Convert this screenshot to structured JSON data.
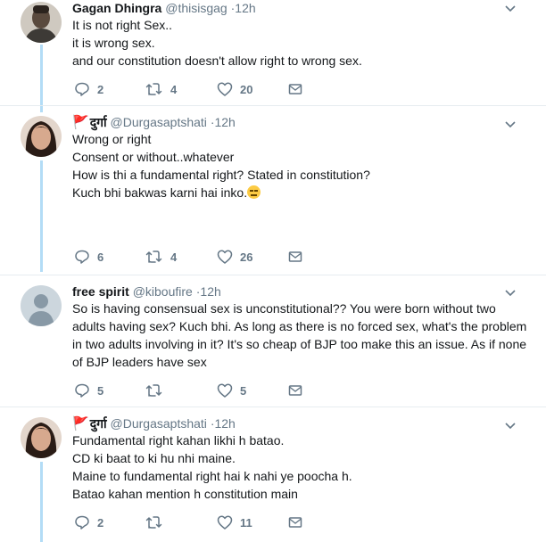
{
  "tweets": [
    {
      "name": "Gagan Dhingra",
      "handle": "@thisisgag",
      "time": "12h",
      "lines": [
        "It is not right Sex..",
        "it is wrong sex.",
        "and our constitution doesn't allow right to wrong sex."
      ],
      "replies": "2",
      "retweets": "4",
      "likes": "20"
    },
    {
      "flag": "🚩",
      "name": "दुर्गा",
      "handle": "@Durgasaptshati",
      "time": "12h",
      "lines": [
        "Wrong or right",
        "Consent or without..whatever",
        "",
        "How is thi a fundamental right? Stated in constitution?",
        "",
        "Kuch bhi bakwas karni hai inko."
      ],
      "emoji": "expressionless-face",
      "replies": "6",
      "retweets": "4",
      "likes": "26"
    },
    {
      "name": "free spirit",
      "handle": "@kiboufire",
      "time": "12h",
      "lines": [
        "So is having consensual sex is unconstitutional?? You were born without two",
        "adults having sex? Kuch bhi. As long as there is no forced sex, what's the problem",
        "in two adults involving in it? It's so cheap of BJP too make this an issue. As if none",
        "of BJP leaders have sex"
      ],
      "replies": "5",
      "retweets": "",
      "likes": "5"
    },
    {
      "flag": "🚩",
      "name": "दुर्गा",
      "handle": "@Durgasaptshati",
      "time": "12h",
      "lines": [
        "Fundamental right kahan likhi h batao.",
        "CD ki baat to ki hu nhi maine.",
        "Maine to fundamental right hai k nahi ye poocha h.",
        "Batao kahan mention h constitution main"
      ],
      "replies": "2",
      "retweets": "",
      "likes": "11"
    }
  ],
  "separator": "·",
  "icons": [
    "reply-icon",
    "retweet-icon",
    "like-icon",
    "direct-message-icon",
    "caret-down-icon",
    "red-flag-icon",
    "expressionless-face-emoji"
  ],
  "colors": {
    "thread_line": "#b3dcf6",
    "text": "#14171a",
    "muted": "#657786"
  }
}
